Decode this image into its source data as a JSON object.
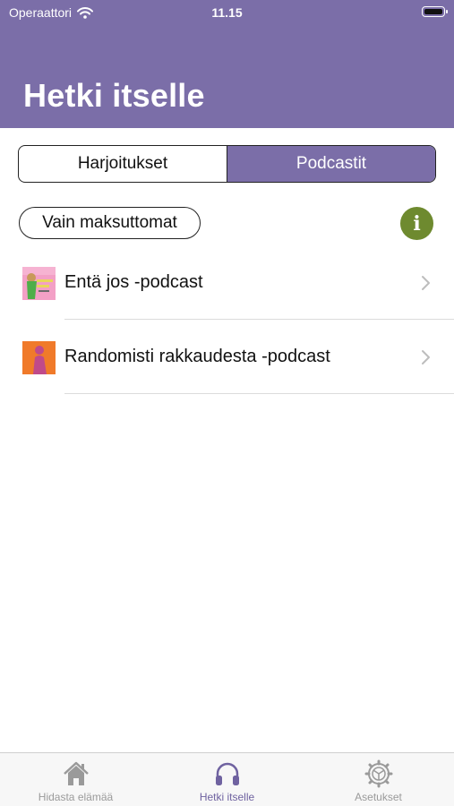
{
  "status_bar": {
    "carrier": "Operaattori",
    "time": "11.15"
  },
  "header": {
    "title": "Hetki itselle",
    "background": "#7b6ea8"
  },
  "segmented": {
    "segments": [
      {
        "label": "Harjoitukset",
        "selected": false
      },
      {
        "label": "Podcastit",
        "selected": true
      }
    ],
    "active_color": "#7b6ea8"
  },
  "filter": {
    "label": "Vain maksuttomat",
    "info_icon": "info-icon",
    "info_glyph": "i",
    "info_color": "#6e8a2f"
  },
  "list": {
    "items": [
      {
        "title": "Entä jos -podcast",
        "thumb": "enta-jos-cover"
      },
      {
        "title": "Randomisti rakkaudesta -podcast",
        "thumb": "randomisti-cover"
      }
    ]
  },
  "tab_bar": {
    "tabs": [
      {
        "label": "Hidasta elämää",
        "icon": "home-icon",
        "selected": false
      },
      {
        "label": "Hetki itselle",
        "icon": "headphones-icon",
        "selected": true
      },
      {
        "label": "Asetukset",
        "icon": "settings-icon",
        "selected": false
      }
    ],
    "active_color": "#6f62a0",
    "inactive_color": "#9a9a9a"
  }
}
